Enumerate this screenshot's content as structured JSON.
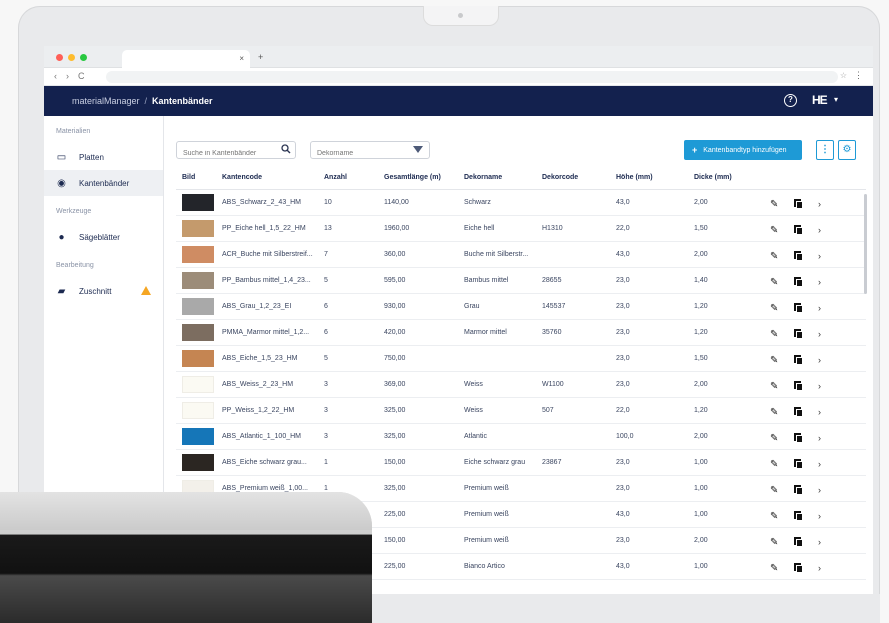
{
  "browser": {
    "traffic_colors": [
      "#ff5f57",
      "#febc2e",
      "#28c840"
    ],
    "tab_close": "×",
    "new_tab": "+",
    "nav": {
      "back": "‹",
      "forward": "›",
      "reload": "C"
    },
    "star": "☆",
    "menu": "⋮"
  },
  "appbar": {
    "root": "materialManager",
    "separator": "/",
    "current": "Kantenbänder",
    "help": "?",
    "logo": "HE",
    "logo_caret": "▾",
    "background": "#13214e"
  },
  "sidebar": {
    "sections": [
      {
        "title": "Materialien",
        "items": [
          {
            "label": "Platten",
            "icon": "panel-icon",
            "glyph": "▭"
          },
          {
            "label": "Kantenbänder",
            "icon": "edgeband-icon",
            "glyph": "◉",
            "active": true
          }
        ]
      },
      {
        "title": "Werkzeuge",
        "items": [
          {
            "label": "Sägeblätter",
            "icon": "sawblade-icon",
            "glyph": "●"
          }
        ]
      },
      {
        "title": "Bearbeitung",
        "items": [
          {
            "label": "Zuschnitt",
            "icon": "cutting-icon",
            "glyph": "▰",
            "warning": true
          }
        ]
      }
    ]
  },
  "toolbar": {
    "search_placeholder": "Suche in Kantenbänder",
    "dekor_placeholder": "Dekorname",
    "add_label": "Kantenbandtyp hinzufügen",
    "add_plus": "+",
    "columns_glyph": "⋮",
    "settings_glyph": "⚙",
    "accent": "#1e9ad6"
  },
  "table": {
    "headers": {
      "bild": "Bild",
      "code": "Kantencode",
      "anzahl": "Anzahl",
      "laenge": "Gesamtlänge (m)",
      "dekorname": "Dekorname",
      "dekorcode": "Dekorcode",
      "hoehe": "Höhe (mm)",
      "dicke": "Dicke (mm)"
    },
    "actions": {
      "edit": "✎",
      "more": "›"
    },
    "rows": [
      {
        "color": "#23252a",
        "code": "ABS_Schwarz_2_43_HM",
        "anzahl": "10",
        "laenge": "1140,00",
        "dekorname": "Schwarz",
        "dekorcode": "",
        "hoehe": "43,0",
        "dicke": "2,00"
      },
      {
        "color": "#c49a6c",
        "code": "PP_Eiche hell_1,5_22_HM",
        "anzahl": "13",
        "laenge": "1960,00",
        "dekorname": "Eiche hell",
        "dekorcode": "H1310",
        "hoehe": "22,0",
        "dicke": "1,50"
      },
      {
        "color": "#cf8c63",
        "code": "ACR_Buche mit Silberstreif...",
        "anzahl": "7",
        "laenge": "360,00",
        "dekorname": "Buche mit Silberstr...",
        "dekorcode": "",
        "hoehe": "43,0",
        "dicke": "2,00"
      },
      {
        "color": "#9c8c79",
        "code": "PP_Bambus mittel_1,4_23...",
        "anzahl": "5",
        "laenge": "595,00",
        "dekorname": "Bambus mittel",
        "dekorcode": "28655",
        "hoehe": "23,0",
        "dicke": "1,40"
      },
      {
        "color": "#a9a9a9",
        "code": "ABS_Grau_1,2_23_EI",
        "anzahl": "6",
        "laenge": "930,00",
        "dekorname": "Grau",
        "dekorcode": "145537",
        "hoehe": "23,0",
        "dicke": "1,20"
      },
      {
        "color": "#7c6d60",
        "code": "PMMA_Marmor mittel_1,2...",
        "anzahl": "6",
        "laenge": "420,00",
        "dekorname": "Marmor mittel",
        "dekorcode": "35760",
        "hoehe": "23,0",
        "dicke": "1,20"
      },
      {
        "color": "#c58552",
        "code": "ABS_Eiche_1,5_23_HM",
        "anzahl": "5",
        "laenge": "750,00",
        "dekorname": "",
        "dekorcode": "",
        "hoehe": "23,0",
        "dicke": "1,50"
      },
      {
        "color": "#fbfaf3",
        "code": "ABS_Weiss_2_23_HM",
        "anzahl": "3",
        "laenge": "369,00",
        "dekorname": "Weiss",
        "dekorcode": "W1100",
        "hoehe": "23,0",
        "dicke": "2,00"
      },
      {
        "color": "#fbfaf3",
        "code": "PP_Weiss_1,2_22_HM",
        "anzahl": "3",
        "laenge": "325,00",
        "dekorname": "Weiss",
        "dekorcode": "507",
        "hoehe": "22,0",
        "dicke": "1,20"
      },
      {
        "color": "#1576b8",
        "code": "ABS_Atlantic_1_100_HM",
        "anzahl": "3",
        "laenge": "325,00",
        "dekorname": "Atlantic",
        "dekorcode": "",
        "hoehe": "100,0",
        "dicke": "2,00"
      },
      {
        "color": "#2b2622",
        "code": "ABS_Eiche schwarz grau...",
        "anzahl": "1",
        "laenge": "150,00",
        "dekorname": "Eiche schwarz grau",
        "dekorcode": "23867",
        "hoehe": "23,0",
        "dicke": "1,00"
      },
      {
        "color": "#f3f0ea",
        "code": "ABS_Premium weiß_1,00...",
        "anzahl": "1",
        "laenge": "325,00",
        "dekorname": "Premium weiß",
        "dekorcode": "",
        "hoehe": "23,0",
        "dicke": "1,00"
      },
      {
        "color": "#f6f4ef",
        "code": "",
        "anzahl": "",
        "laenge": "225,00",
        "dekorname": "Premium weiß",
        "dekorcode": "",
        "hoehe": "43,0",
        "dicke": "1,00"
      },
      {
        "color": "#f2f0eb",
        "code": "",
        "anzahl": "",
        "laenge": "150,00",
        "dekorname": "Premium weiß",
        "dekorcode": "",
        "hoehe": "23,0",
        "dicke": "2,00"
      },
      {
        "color": "#f0eeea",
        "code": "",
        "anzahl": "",
        "laenge": "225,00",
        "dekorname": "Bianco Artico",
        "dekorcode": "",
        "hoehe": "43,0",
        "dicke": "1,00"
      }
    ]
  }
}
